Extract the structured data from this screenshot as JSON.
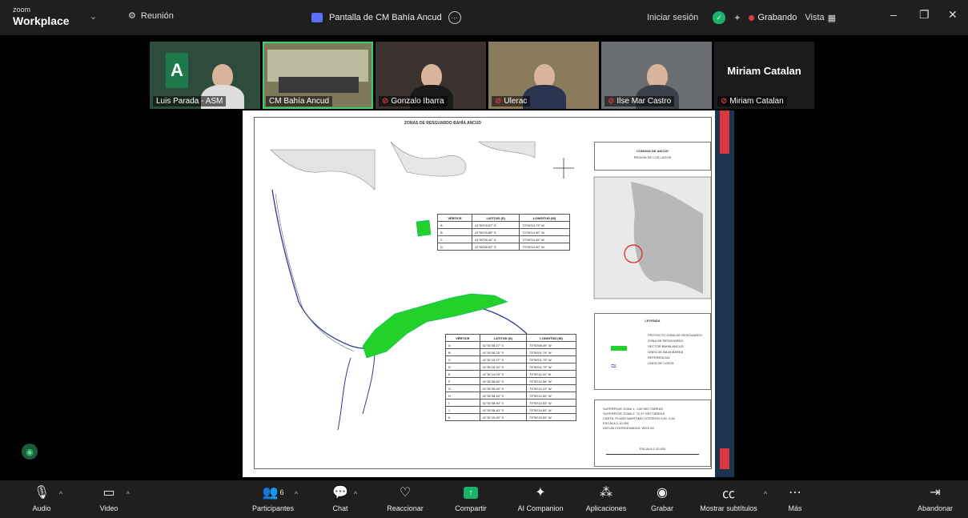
{
  "app": {
    "brand_small": "zoom",
    "brand_big": "Workplace"
  },
  "meeting": {
    "label": "Reunión"
  },
  "share_bar": {
    "label": "Pantalla de CM Bahía Ancud"
  },
  "header": {
    "signin": "Iniciar sesión",
    "recording": "Grabando",
    "view": "Vista"
  },
  "participants": [
    {
      "name": "Luis Parada - ASM",
      "muted": false
    },
    {
      "name": "CM Bahía Ancud",
      "muted": false,
      "active": true
    },
    {
      "name": "Gonzalo Ibarra",
      "muted": true
    },
    {
      "name": "Ulerac",
      "muted": true
    },
    {
      "name": "Ilse Mar Castro",
      "muted": true
    },
    {
      "name": "Miriam Catalan",
      "muted": true,
      "avatar_name": "Miriam Catalan"
    }
  ],
  "shared_map": {
    "title": "ZONAS DE RESGUARDO BAHÍA ANCUD",
    "region_title": "COMUNA DE ANCUD",
    "region_sub": "REGIÓN DE LOS LAGOS",
    "legend_title": "LEYENDA",
    "legend_items": [
      "PROYECTO ZONA DE RESGUARDO",
      "ZONA DE RESGUARDO",
      "SECTOR BAHÍA ANCUD",
      "LÍNEA DE BAJA MAREA REFERENCIAL",
      "LÍNEA DE COSTA"
    ],
    "notes": [
      "SUPERFICIE ZONA 1: 4,00 HECTÁREAS",
      "SUPERFICIE ZONA 2: 72,37 HECTÁREAS",
      "CARTA: PLANO MARÍTIMO COSTERO 0,50, 0,50",
      "ESCALA 1:10.000",
      "DATUM COORDENADAS: WGS 84"
    ],
    "scale_label": "ESCALA 1:10.000",
    "table1": {
      "headers": [
        "VÉRTICE",
        "LATITUD (S)",
        "LONGITUD (W)"
      ],
      "rows": [
        [
          "A",
          "41°50'03.87\" S",
          "73°50'14.73\" W"
        ],
        [
          "B",
          "41°50'03.86\" S",
          "73°50'14.90\" W"
        ],
        [
          "C",
          "41°50'05.42\" S",
          "73°50'14.45\" W"
        ],
        [
          "D",
          "41°50'05.92\" S",
          "73°50'14.90\" W"
        ]
      ]
    },
    "table2": {
      "headers": [
        "VÉRTICE",
        "LATITUD (S)",
        "LONGITUD (W)"
      ],
      "rows": [
        [
          "A",
          "41°51'08.47\" S",
          "73°50'08.49\" W"
        ],
        [
          "B",
          "41°51'08.25\" S",
          "73°50'01.79\" W"
        ],
        [
          "C",
          "41°51'15.37\" S",
          "73°50'01.79\" W"
        ],
        [
          "D",
          "41°51'15.32\" S",
          "73°50'01.79\" W"
        ],
        [
          "E",
          "41°51'14.09\" S",
          "73°50'11.04\" W"
        ],
        [
          "F",
          "41°51'08.60\" S",
          "73°50'14.08\" W"
        ],
        [
          "G",
          "41°51'09.40\" S",
          "73°50'12.12\" W"
        ],
        [
          "H",
          "41°51'08.40\" S",
          "73°50'14.00\" W"
        ],
        [
          "I",
          "41°51'08.40\" S",
          "73°50'14.00\" W"
        ],
        [
          "J",
          "41°51'08.40\" S",
          "73°50'14.00\" W"
        ],
        [
          "K",
          "41°51'15.90\" S",
          "73°50'15.00\" W"
        ]
      ]
    }
  },
  "toolbar": {
    "audio": "Audio",
    "video": "Video",
    "participants": "Participantes",
    "participants_count": "6",
    "chat": "Chat",
    "react": "Reaccionar",
    "share": "Compartir",
    "ai": "AI Companion",
    "apps": "Aplicaciones",
    "record": "Grabar",
    "captions": "Mostrar subtítulos",
    "more": "Más",
    "leave": "Abandonar"
  },
  "colors": {
    "accent_green": "#1bb36a",
    "record_red": "#e23b3b",
    "zone_green": "#22d12a"
  }
}
